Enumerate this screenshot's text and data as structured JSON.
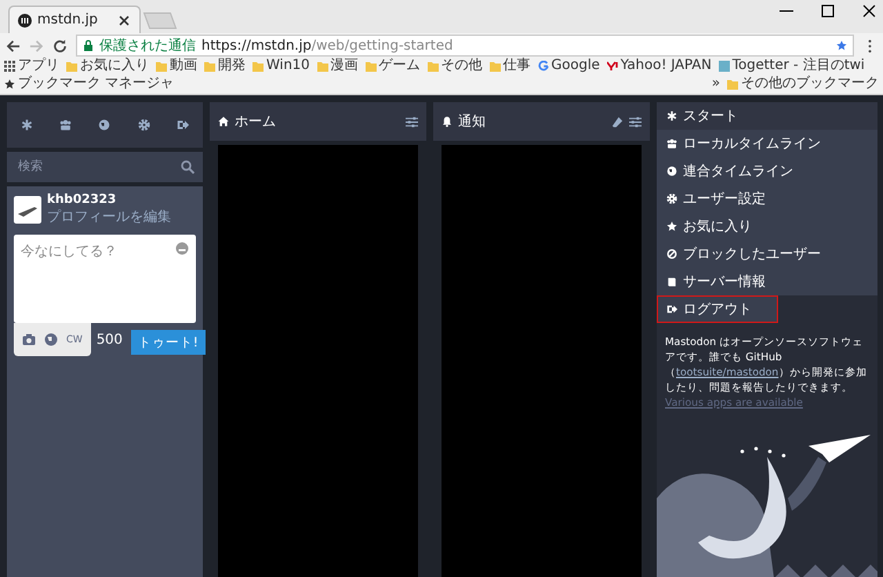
{
  "browser": {
    "tab_title": "mstdn.jp",
    "secure_label": "保護された通信",
    "url_host": "https://mstdn.jp",
    "url_path": "/web/getting-started",
    "bookmarks": [
      {
        "label": "アプリ",
        "kind": "apps"
      },
      {
        "label": "お気に入り",
        "kind": "folder"
      },
      {
        "label": "動画",
        "kind": "folder"
      },
      {
        "label": "開発",
        "kind": "folder"
      },
      {
        "label": "Win10",
        "kind": "folder"
      },
      {
        "label": "漫画",
        "kind": "folder"
      },
      {
        "label": "ゲーム",
        "kind": "folder"
      },
      {
        "label": "その他",
        "kind": "folder"
      },
      {
        "label": "仕事",
        "kind": "folder"
      },
      {
        "label": "Google",
        "kind": "google"
      },
      {
        "label": "Yahoo! JAPAN",
        "kind": "yahoo"
      },
      {
        "label": "Togetter - 注目のtwi",
        "kind": "site"
      },
      {
        "label": "ブックマーク マネージャ",
        "kind": "star"
      }
    ],
    "more": "»",
    "other_bookmarks": "その他のブックマーク"
  },
  "compose": {
    "search": {
      "placeholder": "検索"
    },
    "username": "khb02323",
    "edit_profile": "プロフィールを編集",
    "textarea": {
      "placeholder": "今なにしてる？"
    },
    "cw": "CW",
    "counter": "500",
    "toot_button": "トゥート!"
  },
  "columns": [
    {
      "title": "ホーム",
      "kind": "home"
    },
    {
      "title": "通知",
      "kind": "notifications"
    }
  ],
  "getting_started": {
    "items": [
      {
        "label": "スタート",
        "kind": "start",
        "highlighted": false
      },
      {
        "label": "ローカルタイムライン",
        "kind": "local",
        "highlighted": false
      },
      {
        "label": "連合タイムライン",
        "kind": "federated",
        "highlighted": false
      },
      {
        "label": "ユーザー設定",
        "kind": "settings",
        "highlighted": false
      },
      {
        "label": "お気に入り",
        "kind": "favourites",
        "highlighted": false
      },
      {
        "label": "ブロックしたユーザー",
        "kind": "blocked",
        "highlighted": false
      },
      {
        "label": "サーバー情報",
        "kind": "info",
        "highlighted": false
      },
      {
        "label": "ログアウト",
        "kind": "logout",
        "highlighted": true
      }
    ],
    "about_before": "Mastodon はオープンソースソフトウェアです。誰でも GitHub（",
    "about_link": "tootsuite/mastodon",
    "about_after": "）から開発に参加したり、問題を報告したりできます。",
    "apps_link": "Various apps are available"
  }
}
